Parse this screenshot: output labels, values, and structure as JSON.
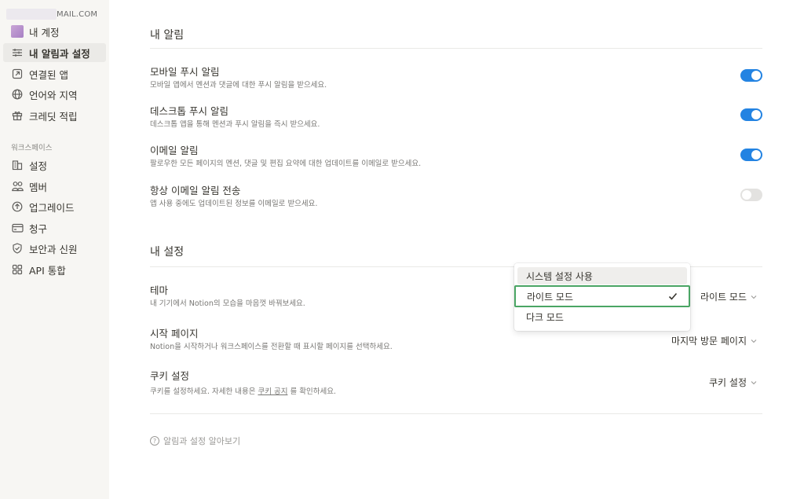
{
  "account": {
    "email": "MAIL.COM"
  },
  "sidebar": {
    "items": [
      {
        "label": "내 계정"
      },
      {
        "label": "내 알림과 설정"
      },
      {
        "label": "연결된 앱"
      },
      {
        "label": "언어와 지역"
      },
      {
        "label": "크레딧 적립"
      }
    ],
    "workspace_label": "워크스페이스",
    "workspace_items": [
      {
        "label": "설정"
      },
      {
        "label": "멤버"
      },
      {
        "label": "업그레이드"
      },
      {
        "label": "청구"
      },
      {
        "label": "보안과 신원"
      },
      {
        "label": "API 통합"
      }
    ]
  },
  "notifications": {
    "heading": "내 알림",
    "rows": [
      {
        "title": "모바일 푸시 알림",
        "desc": "모바일 앱에서 멘션과 댓글에 대한 푸시 알림을 받으세요.",
        "enabled": true
      },
      {
        "title": "데스크톱 푸시 알림",
        "desc": "데스크톱 앱을 통해 멘션과 푸시 알림을 즉시 받으세요.",
        "enabled": true
      },
      {
        "title": "이메일 알림",
        "desc": "팔로우한 모든 페이지의 멘션, 댓글 및 편집 요약에 대한 업데이트를 이메일로 받으세요.",
        "enabled": true
      },
      {
        "title": "항상 이메일 알림 전송",
        "desc": "앱 사용 중에도 업데이트된 정보를 이메일로 받으세요.",
        "enabled": false
      }
    ]
  },
  "settings": {
    "heading": "내 설정",
    "theme": {
      "title": "테마",
      "desc": "내 기기에서 Notion의 모습을 마음껏 바꿔보세요.",
      "value": "라이트 모드"
    },
    "start_page": {
      "title": "시작 페이지",
      "desc": "Notion을 시작하거나 워크스페이스를 전환할 때 표시할 페이지를 선택하세요.",
      "value": "마지막 방문 페이지"
    },
    "cookie": {
      "title": "쿠키 설정",
      "desc_before": "쿠키를 설정하세요. 자세한 내용은 ",
      "desc_link": "쿠키 공지",
      "desc_after": " 를 확인하세요.",
      "value": "쿠키 설정"
    }
  },
  "theme_dropdown": {
    "options": [
      {
        "label": "시스템 설정 사용"
      },
      {
        "label": "라이트 모드",
        "selected": true
      },
      {
        "label": "다크 모드"
      }
    ]
  },
  "help": {
    "label": "알림과 설정 알아보기"
  },
  "colors": {
    "toggle_on": "#2383e2",
    "toggle_off": "#e3e2e0",
    "selected_outline": "#4aa564",
    "sidebar_bg": "#f7f6f3"
  }
}
